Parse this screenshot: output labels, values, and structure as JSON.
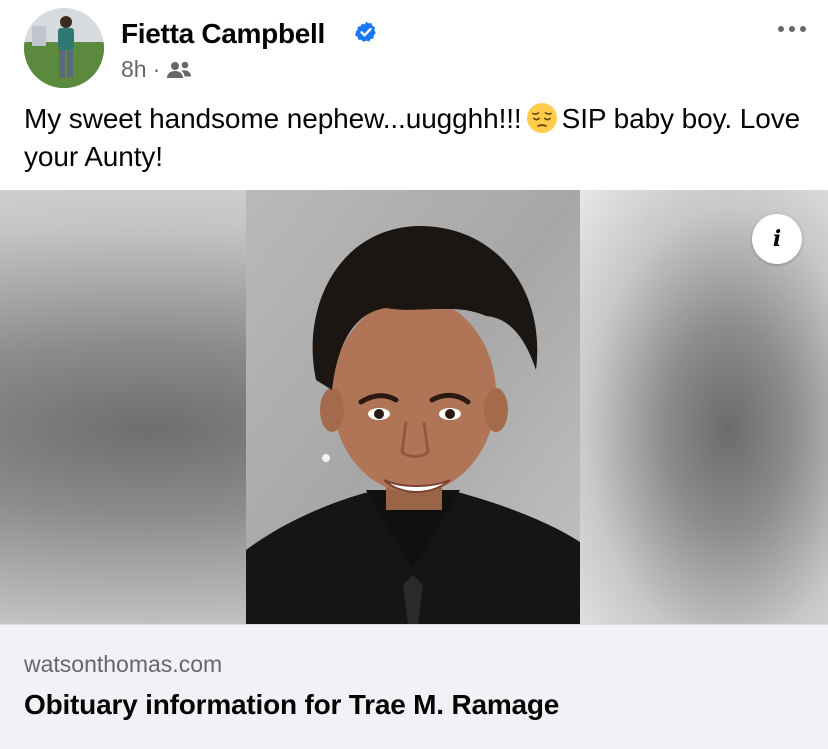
{
  "post": {
    "author": "Fietta Campbell",
    "time": "8h",
    "separator": "·",
    "audience_icon": "friends-icon",
    "text_part1": "My sweet handsome nephew...uugghh!!!",
    "emoji_icon": "pensive-face-emoji",
    "text_part2": "SIP baby boy. Love your Aunty!"
  },
  "link": {
    "domain": "watsonthomas.com",
    "title": "Obituary information for Trae M. Ramage",
    "info_label": "i"
  },
  "colors": {
    "verified": "#1877f2",
    "secondary_text": "#65676b",
    "footer_bg": "#f0f2f5"
  }
}
